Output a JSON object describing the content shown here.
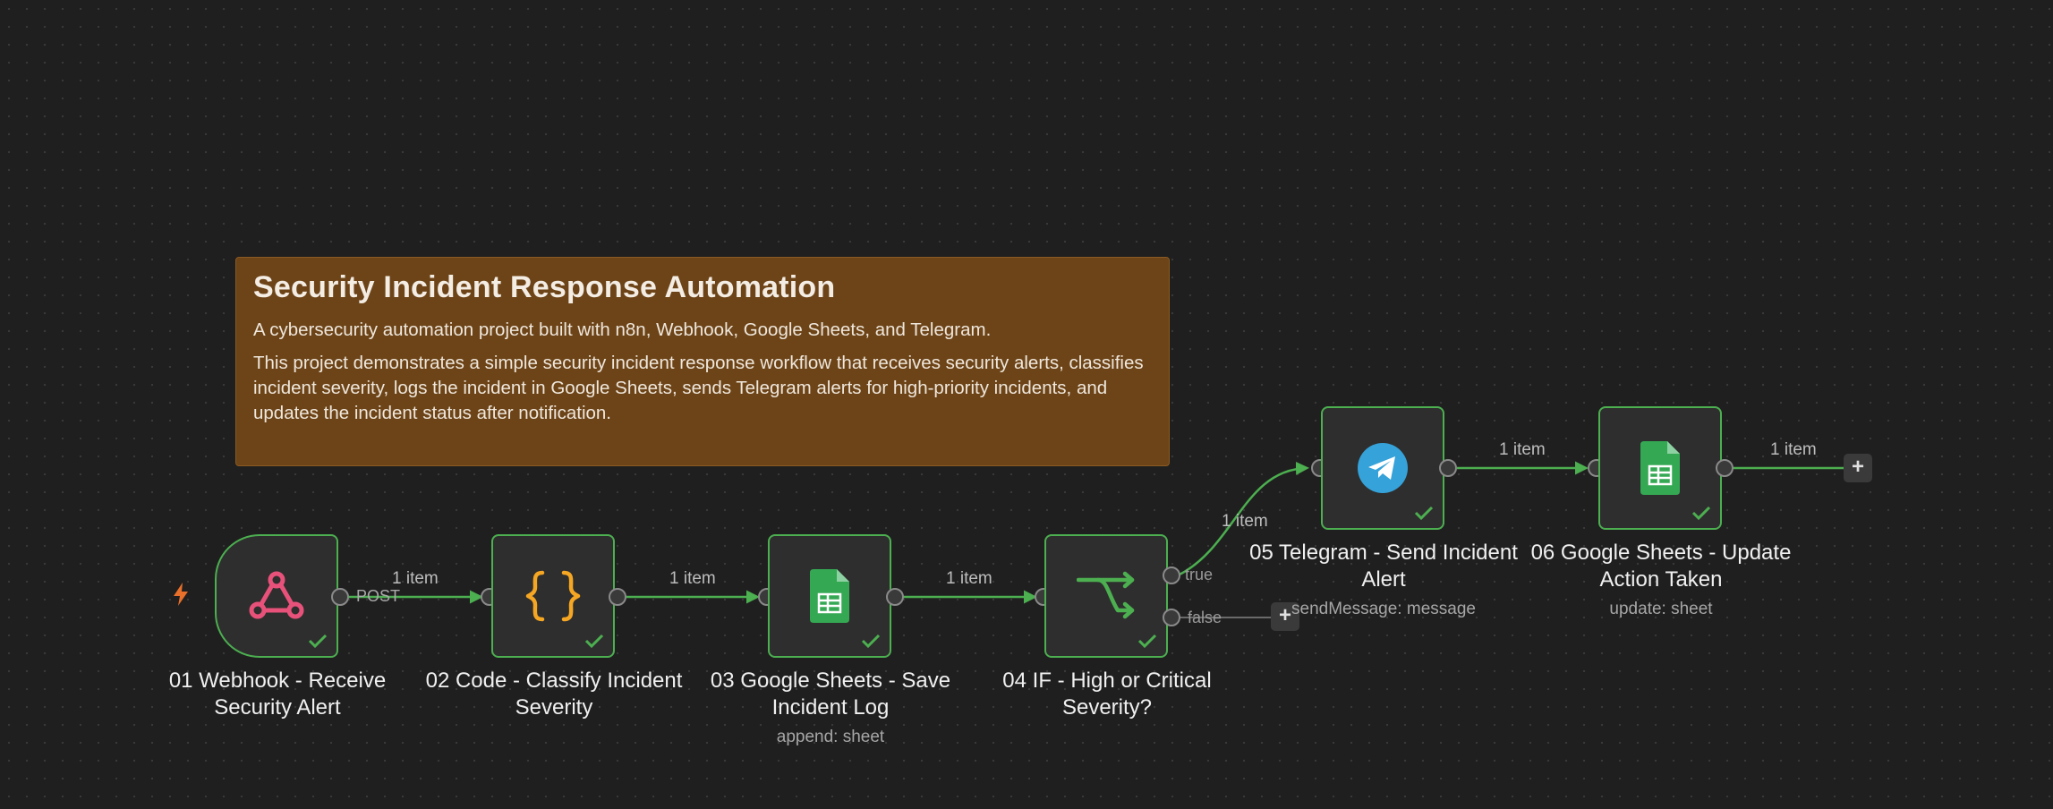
{
  "sticky": {
    "title": "Security Incident Response Automation",
    "line1": "A cybersecurity automation project built with n8n, Webhook, Google Sheets, and Telegram.",
    "line2": "This project demonstrates a simple security incident response workflow that receives security alerts, classifies incident severity, logs the incident in Google Sheets, sends Telegram alerts for high-priority incidents, and updates the incident status after notification."
  },
  "nodes": [
    {
      "label": "01 Webhook - Receive Security Alert",
      "subtitle": "",
      "icon": "webhook-icon"
    },
    {
      "label": "02 Code - Classify Incident Severity",
      "subtitle": "",
      "icon": "code-braces-icon"
    },
    {
      "label": "03 Google Sheets - Save Incident Log",
      "subtitle": "append: sheet",
      "icon": "google-sheets-icon"
    },
    {
      "label": "04 IF - High or Critical Severity?",
      "subtitle": "",
      "icon": "if-branch-icon"
    },
    {
      "label": "05 Telegram - Send Incident Alert",
      "subtitle": "sendMessage: message",
      "icon": "telegram-icon"
    },
    {
      "label": "06 Google Sheets - Update Action Taken",
      "subtitle": "update: sheet",
      "icon": "google-sheets-icon"
    }
  ],
  "edges": {
    "item_label": "1 item",
    "webhook_method": "POST",
    "true_label": "true",
    "false_label": "false"
  },
  "buttons": {
    "add": "+"
  },
  "colors": {
    "canvas_bg": "#1f1f1f",
    "node_border_success": "#4caf50",
    "sticky_bg": "#6d4418",
    "webhook_pink": "#e8517a",
    "code_orange": "#f5a623",
    "sheets_green": "#34a853",
    "telegram_blue": "#35a2d9",
    "trigger_bolt": "#e8702a"
  }
}
